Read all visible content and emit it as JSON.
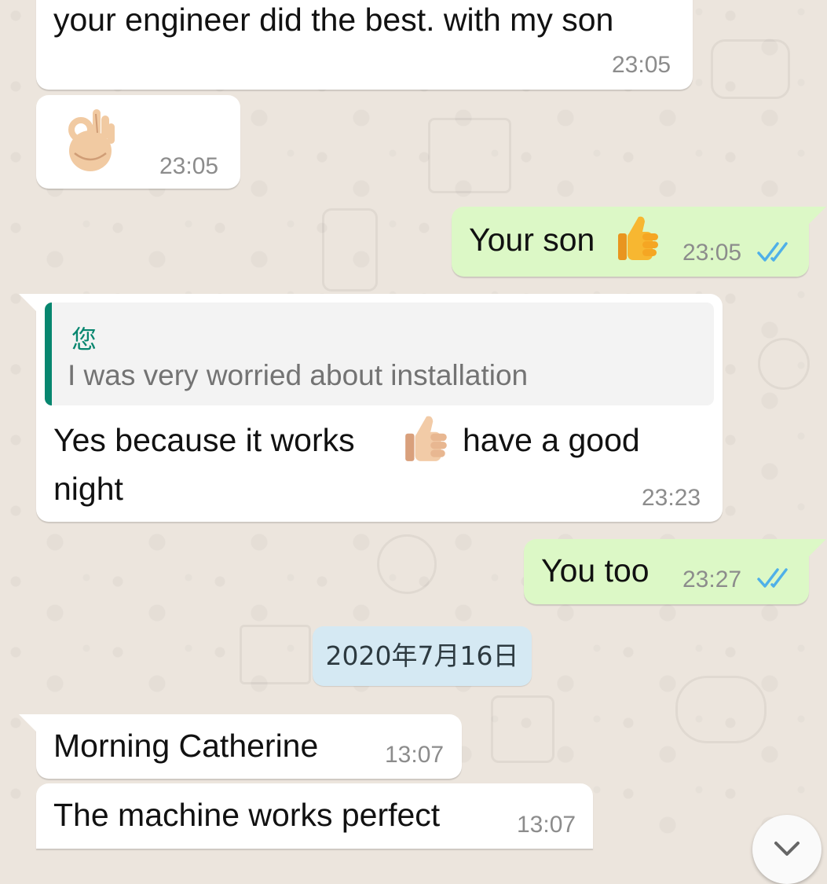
{
  "messages": [
    {
      "id": "m1",
      "direction": "incoming",
      "text": "your engineer did the best. with my son",
      "time": "23:05"
    },
    {
      "id": "m2",
      "direction": "incoming",
      "emoji": "ok-hand",
      "time": "23:05"
    },
    {
      "id": "m3",
      "direction": "outgoing",
      "text": "Your son",
      "emoji": "thumbs-up",
      "time": "23:05",
      "status": "read"
    },
    {
      "id": "m4",
      "direction": "incoming",
      "reply": {
        "author": "您",
        "text": "I was very worried about installation"
      },
      "line1_before": "Yes because it works",
      "emoji": "thumbs-up",
      "line1_after": "have a good",
      "line2": "night",
      "time": "23:23"
    },
    {
      "id": "m5",
      "direction": "outgoing",
      "text": "You too",
      "time": "23:27",
      "status": "read"
    },
    {
      "id": "m6",
      "direction": "incoming",
      "text": "Morning Catherine",
      "time": "13:07"
    },
    {
      "id": "m7",
      "direction": "incoming",
      "text": "The machine works perfect",
      "time": "13:07"
    }
  ],
  "date_separator": "2020年7月16日",
  "scroll_button_icon": "chevron-down-icon",
  "colors": {
    "incoming_bubble": "#ffffff",
    "outgoing_bubble": "#dcf8c6",
    "read_ticks": "#4fb0e8",
    "reply_accent": "#07866f",
    "date_pill": "#d5e9f3",
    "wallpaper": "#ece5dd"
  }
}
